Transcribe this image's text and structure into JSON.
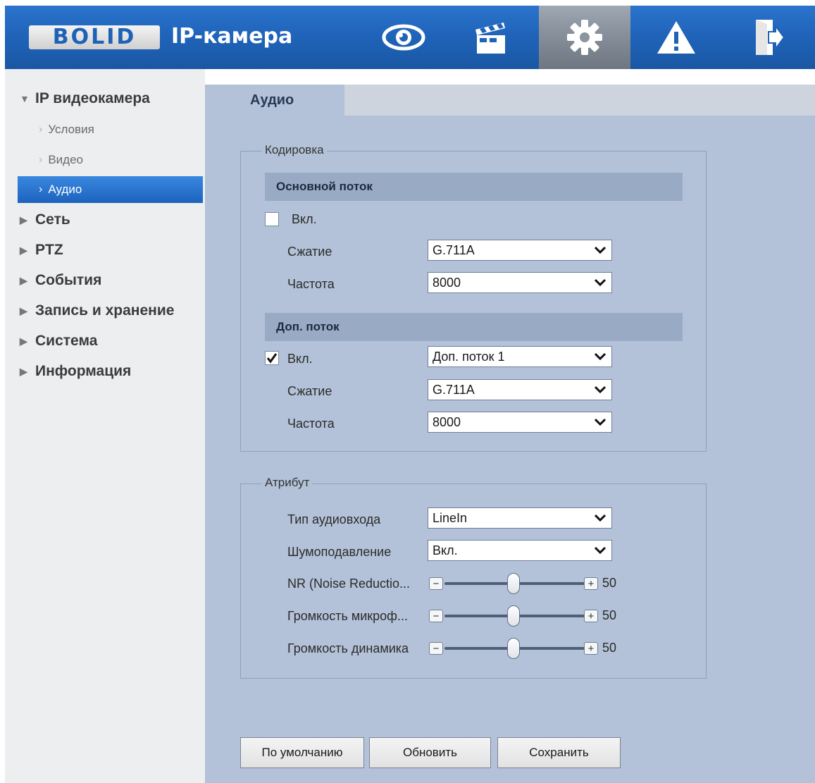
{
  "header": {
    "logo_text": "BOLID",
    "title": "IP-камера",
    "nav": [
      {
        "icon": "eye-icon"
      },
      {
        "icon": "clapperboard-icon"
      },
      {
        "icon": "gear-icon",
        "active": true
      },
      {
        "icon": "warning-icon"
      },
      {
        "icon": "logout-icon"
      }
    ]
  },
  "sidebar": {
    "root": {
      "label": "IP видеокамера",
      "expanded": true
    },
    "children": [
      {
        "label": "Условия"
      },
      {
        "label": "Видео"
      },
      {
        "label": "Аудио",
        "active": true
      }
    ],
    "sections": [
      {
        "label": "Сеть"
      },
      {
        "label": "PTZ"
      },
      {
        "label": "События"
      },
      {
        "label": "Запись и хранение"
      },
      {
        "label": "Система"
      },
      {
        "label": "Информация"
      }
    ]
  },
  "tab": {
    "label": "Аудио"
  },
  "encoding": {
    "legend": "Кодировка",
    "main_stream": {
      "heading": "Основной поток",
      "enable_label": "Вкл.",
      "enabled": false,
      "compression_label": "Сжатие",
      "compression_value": "G.711A",
      "frequency_label": "Частота",
      "frequency_value": "8000"
    },
    "sub_stream": {
      "heading": "Доп. поток",
      "enable_label": "Вкл.",
      "enabled": true,
      "stream_value": "Доп. поток 1",
      "compression_label": "Сжатие",
      "compression_value": "G.711A",
      "frequency_label": "Частота",
      "frequency_value": "8000"
    }
  },
  "attribute": {
    "legend": "Атрибут",
    "input_type_label": "Тип аудиовхода",
    "input_type_value": "LineIn",
    "noise_suppression_label": "Шумоподавление",
    "noise_suppression_value": "Вкл.",
    "sliders": [
      {
        "label": "NR (Noise Reductio...",
        "value": "50"
      },
      {
        "label": "Громкость микроф...",
        "value": "50"
      },
      {
        "label": "Громкость динамика",
        "value": "50"
      }
    ],
    "minus_symbol": "−",
    "plus_symbol": "+"
  },
  "buttons": {
    "default": "По умолчанию",
    "refresh": "Обновить",
    "save": "Сохранить"
  }
}
